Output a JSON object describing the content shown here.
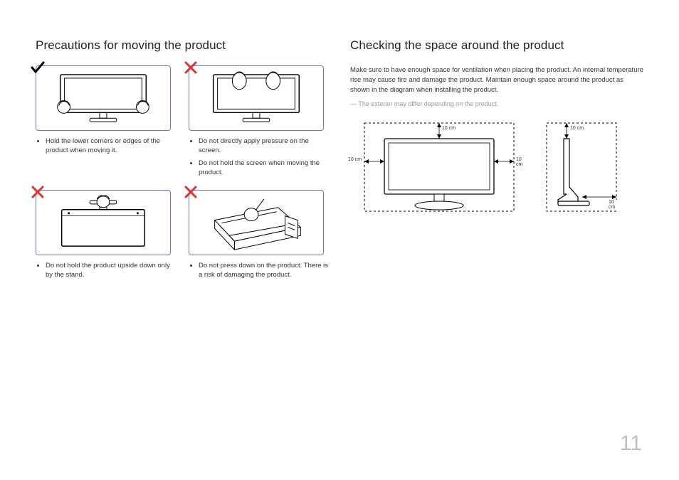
{
  "page_number": "11",
  "left": {
    "heading": "Precautions for moving the product",
    "cells": [
      {
        "mark": "check",
        "bullets": [
          "Hold the lower corners or edges of the product when moving it."
        ]
      },
      {
        "mark": "cross",
        "bullets": [
          "Do not directly apply pressure on the screen.",
          "Do not hold the screen when moving the product."
        ]
      },
      {
        "mark": "cross",
        "bullets": [
          "Do not hold the product upside down only by the stand."
        ]
      },
      {
        "mark": "cross",
        "bullets": [
          "Do not press down on the product. There is a risk of damaging the product."
        ]
      }
    ]
  },
  "right": {
    "heading": "Checking the space around the product",
    "intro": "Make sure to have enough space for ventilation when placing the product. An internal temperature rise may cause fire and damage the product. Maintain enough space around the product as shown in the diagram when installing the product.",
    "note": "The exterior may differ depending on the product.",
    "clearance": {
      "top": "10 cm",
      "left": "10 cm",
      "right": "10 cm",
      "side_top": "10 cm",
      "side_back": "10 cm"
    }
  }
}
